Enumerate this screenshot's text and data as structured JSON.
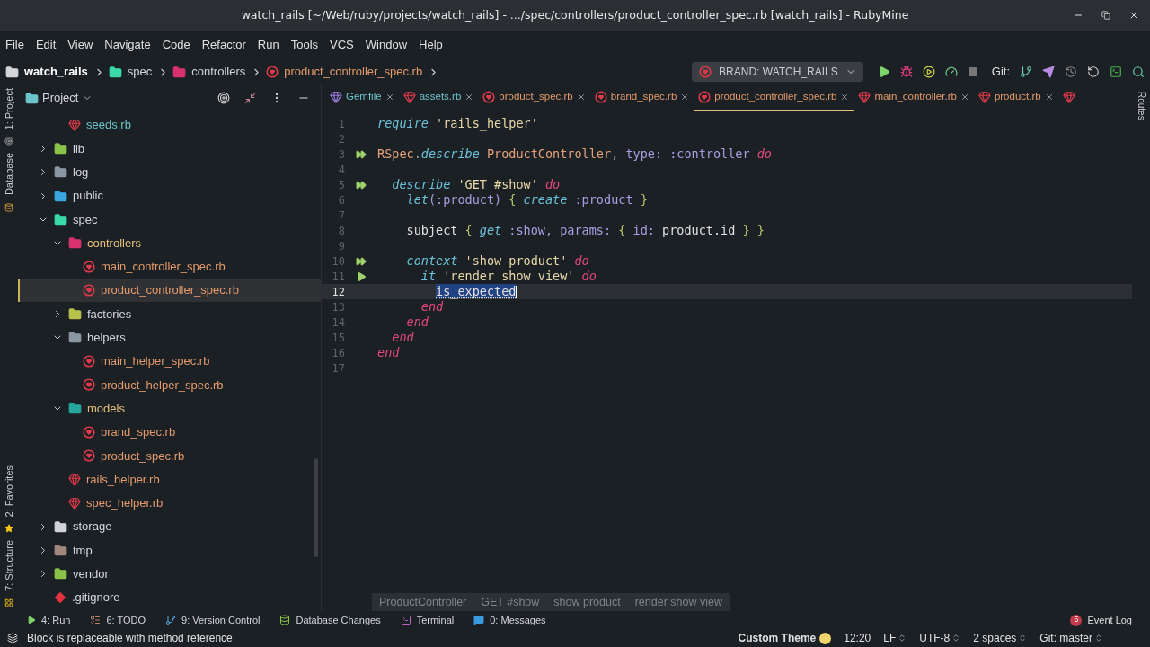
{
  "window": {
    "title": "watch_rails [~/Web/ruby/projects/watch_rails] - .../spec/controllers/product_controller_spec.rb [watch_rails] - RubyMine"
  },
  "menu": [
    "File",
    "Edit",
    "View",
    "Navigate",
    "Code",
    "Refactor",
    "Run",
    "Tools",
    "VCS",
    "Window",
    "Help"
  ],
  "breadcrumb": [
    {
      "kind": "root",
      "label": "watch_rails"
    },
    {
      "kind": "folder",
      "color": "#3ad9a8",
      "label": "spec"
    },
    {
      "kind": "folder",
      "color": "#d8336e",
      "label": "controllers"
    },
    {
      "kind": "file",
      "label": "product_controller_spec.rb"
    }
  ],
  "toolbar": {
    "run_config": "BRAND: WATCH_RAILS",
    "git_label": "Git:"
  },
  "left_strip": [
    "1: Project",
    "Database",
    "2: Favorites",
    "7: Structure"
  ],
  "right_strip": [
    "Routes"
  ],
  "project": {
    "title": "Project",
    "continued": [
      {
        "kind": "ruby",
        "label": "seeds.rb",
        "modified": true,
        "untracked": false,
        "selected": false
      }
    ],
    "items": [
      {
        "kind": "folder",
        "color": "#8bc34a",
        "label": "lib",
        "modified": false,
        "expanded": false,
        "selected": false
      },
      {
        "kind": "folder",
        "color": "#8a97a3",
        "label": "log",
        "modified": false,
        "expanded": false,
        "selected": false
      },
      {
        "kind": "folder",
        "color": "#3aa7e0",
        "label": "public",
        "modified": false,
        "expanded": false,
        "selected": false
      },
      {
        "kind": "folder",
        "color": "#3ad9a8",
        "label": "spec",
        "modified": false,
        "expanded": true,
        "selected": false,
        "children": [
          {
            "kind": "folder",
            "color": "#d8336e",
            "label": "controllers",
            "modified": true,
            "expanded": true,
            "selected": false,
            "children": [
              {
                "kind": "rspec",
                "label": "main_controller_spec.rb",
                "modified": false,
                "untracked": true,
                "selected": false
              },
              {
                "kind": "rspec",
                "label": "product_controller_spec.rb",
                "modified": false,
                "untracked": true,
                "selected": true
              }
            ]
          },
          {
            "kind": "folder",
            "color": "#b7c34a",
            "label": "factories",
            "modified": false,
            "expanded": false,
            "selected": false
          },
          {
            "kind": "folder",
            "color": "#8a97a3",
            "label": "helpers",
            "modified": false,
            "expanded": true,
            "selected": false,
            "children": [
              {
                "kind": "rspec",
                "label": "main_helper_spec.rb",
                "modified": false,
                "untracked": true,
                "selected": false
              },
              {
                "kind": "rspec",
                "label": "product_helper_spec.rb",
                "modified": false,
                "untracked": true,
                "selected": false
              }
            ]
          },
          {
            "kind": "folder",
            "color": "#26a69a",
            "label": "models",
            "modified": true,
            "expanded": true,
            "selected": false,
            "children": [
              {
                "kind": "rspec",
                "label": "brand_spec.rb",
                "modified": false,
                "untracked": true,
                "selected": false
              },
              {
                "kind": "rspec",
                "label": "product_spec.rb",
                "modified": false,
                "untracked": true,
                "selected": false
              }
            ]
          },
          {
            "kind": "ruby",
            "label": "rails_helper.rb",
            "modified": false,
            "untracked": true,
            "selected": false
          },
          {
            "kind": "ruby",
            "label": "spec_helper.rb",
            "modified": false,
            "untracked": true,
            "selected": false
          }
        ]
      },
      {
        "kind": "folder",
        "color": "#d0d4d8",
        "label": "storage",
        "modified": false,
        "expanded": false,
        "selected": false
      },
      {
        "kind": "folder",
        "color": "#a1887f",
        "label": "tmp",
        "modified": false,
        "expanded": false,
        "selected": false
      },
      {
        "kind": "folder",
        "color": "#8bc34a",
        "label": "vendor",
        "modified": false,
        "expanded": false,
        "selected": false
      },
      {
        "kind": "git",
        "label": ".gitignore",
        "modified": false,
        "untracked": false,
        "selected": false
      }
    ]
  },
  "tabs": [
    {
      "kind": "gemfile",
      "label": "Gemfile",
      "modified": true,
      "untracked": false,
      "selected": false
    },
    {
      "kind": "ruby",
      "label": "assets.rb",
      "modified": true,
      "untracked": false,
      "selected": false
    },
    {
      "kind": "rspec",
      "label": "product_spec.rb",
      "modified": false,
      "untracked": true,
      "selected": false
    },
    {
      "kind": "rspec",
      "label": "brand_spec.rb",
      "modified": false,
      "untracked": true,
      "selected": false
    },
    {
      "kind": "rspec",
      "label": "product_controller_spec.rb",
      "modified": false,
      "untracked": true,
      "selected": true
    },
    {
      "kind": "ruby",
      "label": "main_controller.rb",
      "modified": false,
      "untracked": true,
      "selected": false
    },
    {
      "kind": "ruby",
      "label": "product.rb",
      "modified": false,
      "untracked": true,
      "selected": false
    },
    {
      "kind": "ruby",
      "selected": false
    }
  ],
  "code": [
    {
      "number": "1",
      "current": false,
      "tokens": [
        {
          "kind": "kw",
          "text": "require"
        },
        {
          "kind": "str",
          "text": " 'rails_helper'"
        }
      ]
    },
    {
      "number": "2",
      "current": false
    },
    {
      "number": "3",
      "kind": "group",
      "current": false,
      "tokens": [
        {
          "kind": "const",
          "text": "RSpec"
        },
        {
          "kind": "punct",
          "text": "."
        },
        {
          "kind": "kw",
          "text": "describe"
        },
        {
          "kind": "const",
          "text": " ProductController"
        },
        {
          "kind": "punct",
          "text": ","
        },
        {
          "kind": "sym",
          "text": " type: :controller"
        },
        {
          "kind": "do",
          "text": " do"
        }
      ]
    },
    {
      "number": "4",
      "current": false
    },
    {
      "number": "5",
      "kind": "group",
      "current": false,
      "tokens": [
        {
          "kind": "kw",
          "text": "  describe"
        },
        {
          "kind": "str",
          "text": " 'GET #show'"
        },
        {
          "kind": "do",
          "text": " do"
        }
      ]
    },
    {
      "number": "6",
      "current": false,
      "tokens": [
        {
          "kind": "kw",
          "text": "    let"
        },
        {
          "kind": "sym",
          "text": "(:product)"
        },
        {
          "kind": "brace",
          "text": " {"
        },
        {
          "kind": "kw",
          "text": " create"
        },
        {
          "kind": "sym",
          "text": " :product"
        },
        {
          "kind": "brace",
          "text": " }"
        }
      ]
    },
    {
      "number": "7",
      "current": false
    },
    {
      "number": "8",
      "current": false,
      "tokens": [
        {
          "kind": "ident",
          "text": "    subject"
        },
        {
          "kind": "brace",
          "text": " {"
        },
        {
          "kind": "kw",
          "text": " get"
        },
        {
          "kind": "sym",
          "text": " :show, params:"
        },
        {
          "kind": "brace",
          "text": " {"
        },
        {
          "kind": "sym",
          "text": " id:"
        },
        {
          "kind": "ident",
          "text": " product.id"
        },
        {
          "kind": "brace",
          "text": " } }"
        }
      ]
    },
    {
      "number": "9",
      "current": false
    },
    {
      "number": "10",
      "kind": "group",
      "current": false,
      "tokens": [
        {
          "kind": "kw",
          "text": "    context"
        },
        {
          "kind": "str",
          "text": " 'show product'"
        },
        {
          "kind": "do",
          "text": " do"
        }
      ]
    },
    {
      "number": "11",
      "kind": "example",
      "current": false,
      "tokens": [
        {
          "kind": "kw",
          "text": "      it"
        },
        {
          "kind": "str",
          "text": " 'render show view'"
        },
        {
          "kind": "do",
          "text": " do"
        }
      ]
    },
    {
      "number": "12",
      "current": true,
      "tokens": [
        {
          "kind": "selected",
          "text": "is_expected"
        }
      ]
    },
    {
      "number": "13",
      "current": false,
      "tokens": [
        {
          "kind": "do",
          "text": "      end"
        }
      ]
    },
    {
      "number": "14",
      "current": false,
      "tokens": [
        {
          "kind": "do",
          "text": "    end"
        }
      ]
    },
    {
      "number": "15",
      "current": false,
      "tokens": [
        {
          "kind": "do",
          "text": "  end"
        }
      ]
    },
    {
      "number": "16",
      "current": false,
      "tokens": [
        {
          "kind": "do",
          "text": "end"
        }
      ]
    },
    {
      "number": "17",
      "current": false
    }
  ],
  "editor_breadcrumb": [
    "ProductController",
    "GET #show",
    "show product",
    "render show view"
  ],
  "tool_buttons": [
    {
      "kind": "run",
      "label": "4: Run"
    },
    {
      "kind": "todo",
      "label": "6: TODO"
    },
    {
      "kind": "vcs",
      "label": "9: Version Control"
    },
    {
      "kind": "db",
      "label": "Database Changes"
    },
    {
      "kind": "terminal",
      "label": "Terminal"
    },
    {
      "kind": "messages",
      "label": "0: Messages"
    }
  ],
  "event_log": {
    "label": "Event Log",
    "count": "5"
  },
  "status_bar": {
    "message": "Block is replaceable with method reference",
    "theme": "Custom Theme",
    "position": "12:20",
    "line_ending": "LF",
    "encoding": "UTF-8",
    "indent": "2 spaces",
    "branch": "Git: master"
  }
}
